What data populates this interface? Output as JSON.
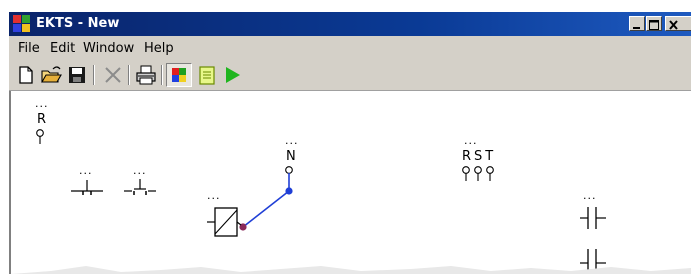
{
  "window": {
    "title": "EKTS - New"
  },
  "menu": {
    "file": "File",
    "edit": "Edit",
    "window": "Window",
    "help": "Help"
  },
  "canvas": {
    "dots": "...",
    "labels": {
      "r": "R",
      "n": "N",
      "rst": "RST"
    }
  },
  "colors": {
    "titlebar": "#0a246a",
    "wire": "#1f3fd6",
    "run": "#1fb51f"
  },
  "icons": [
    "new-icon",
    "open-icon",
    "save-icon",
    "delete-icon",
    "print-icon",
    "color-icon",
    "list-icon",
    "run-icon"
  ]
}
